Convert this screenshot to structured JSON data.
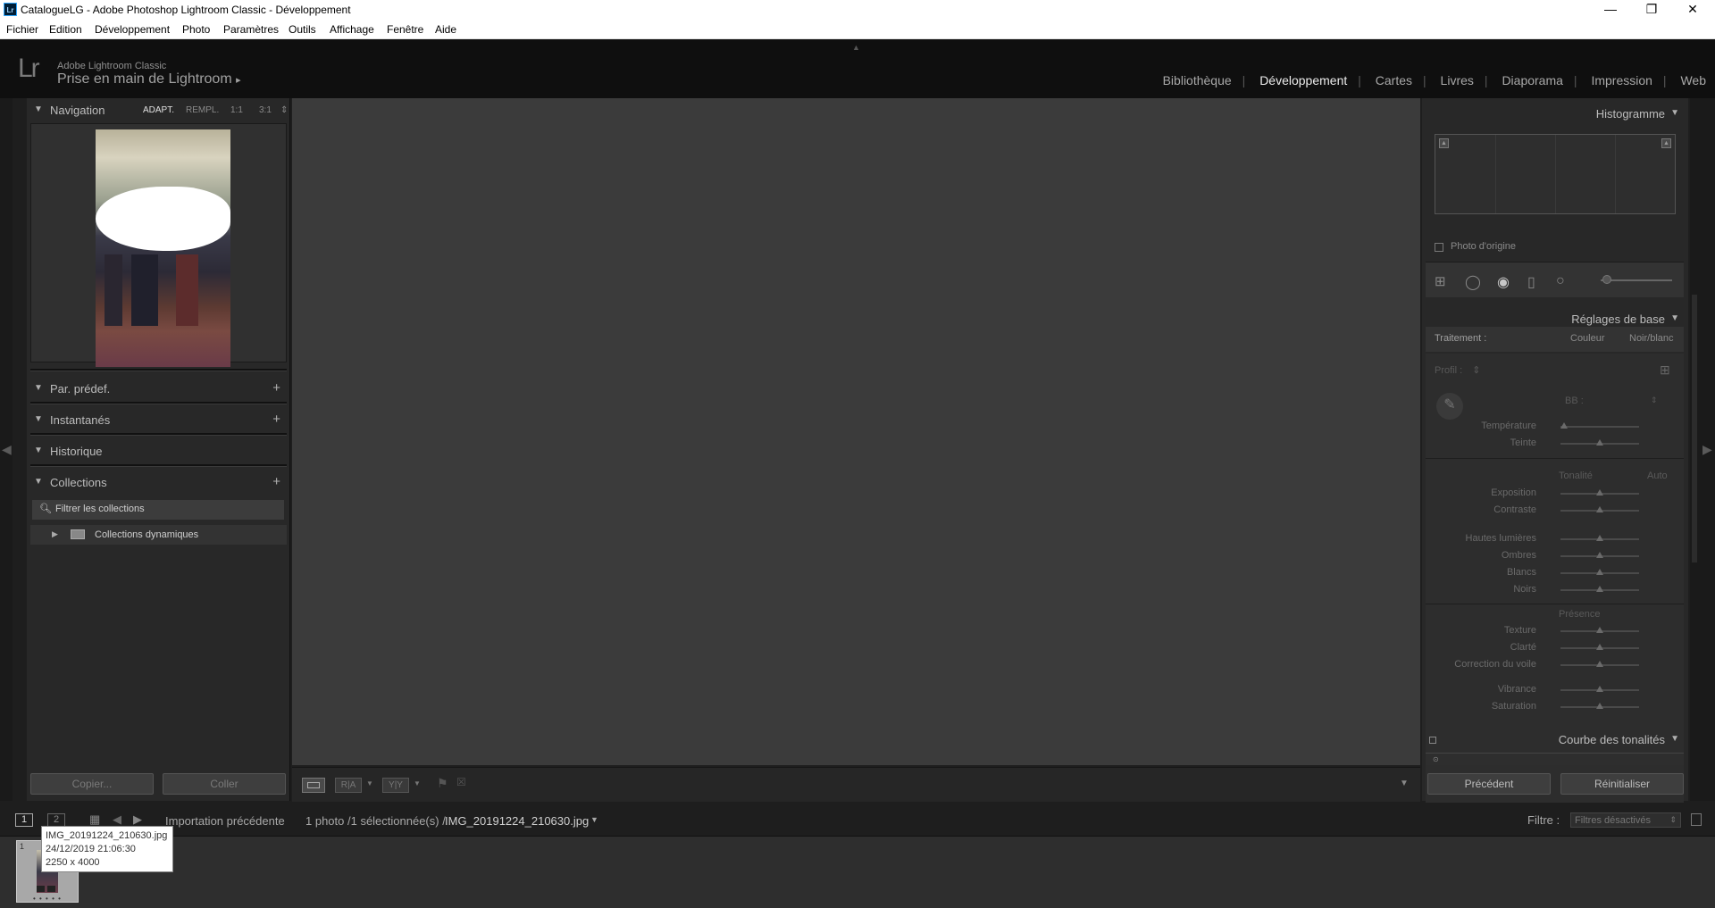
{
  "window": {
    "title": "CatalogueLG - Adobe Photoshop Lightroom Classic - Développement",
    "icon": "Lr",
    "minimize": "—",
    "restore": "❐",
    "close": "✕"
  },
  "menu": [
    "Fichier",
    "Edition",
    "Développement",
    "Photo",
    "Paramètres",
    "Outils",
    "Affichage",
    "Fenêtre",
    "Aide"
  ],
  "identity": {
    "logo": "Lr",
    "app_name": "Adobe Lightroom Classic",
    "catalog_title": "Prise en main de Lightroom",
    "catalog_arrow": "▸"
  },
  "modules": [
    {
      "label": "Bibliothèque",
      "active": false
    },
    {
      "label": "Développement",
      "active": true
    },
    {
      "label": "Cartes",
      "active": false
    },
    {
      "label": "Livres",
      "active": false
    },
    {
      "label": "Diaporama",
      "active": false
    },
    {
      "label": "Impression",
      "active": false
    },
    {
      "label": "Web",
      "active": false
    }
  ],
  "left": {
    "navigation": {
      "title": "Navigation",
      "zoom": [
        "ADAPT.",
        "REMPL.",
        "1:1",
        "3:1"
      ]
    },
    "presets": {
      "title": "Par. prédef."
    },
    "snapshots": {
      "title": "Instantanés"
    },
    "history": {
      "title": "Historique"
    },
    "collections": {
      "title": "Collections",
      "filter_label": "Filtrer les collections",
      "items": [
        {
          "label": "Collections dynamiques"
        }
      ]
    },
    "copy_button": "Copier...",
    "paste_button": "Coller"
  },
  "right": {
    "histogram": {
      "title": "Histogramme",
      "original_photo": "Photo d'origine"
    },
    "basic": {
      "title": "Réglages de base",
      "treatment_label": "Traitement :",
      "color": "Couleur",
      "bw": "Noir/blanc",
      "profile_label": "Profil :",
      "wb_label": "BB :",
      "tone_label": "Tonalité",
      "auto": "Auto",
      "presence_label": "Présence",
      "sliders_wb": [
        {
          "label": "Température",
          "value": 0.05
        },
        {
          "label": "Teinte",
          "value": 0.5
        }
      ],
      "sliders_tone1": [
        {
          "label": "Exposition",
          "value": 0.5
        },
        {
          "label": "Contraste",
          "value": 0.5
        }
      ],
      "sliders_tone2": [
        {
          "label": "Hautes lumières",
          "value": 0.5
        },
        {
          "label": "Ombres",
          "value": 0.5
        },
        {
          "label": "Blancs",
          "value": 0.5
        },
        {
          "label": "Noirs",
          "value": 0.5
        }
      ],
      "sliders_presence1": [
        {
          "label": "Texture",
          "value": 0.5
        },
        {
          "label": "Clarté",
          "value": 0.5
        },
        {
          "label": "Correction du voile",
          "value": 0.5
        }
      ],
      "sliders_presence2": [
        {
          "label": "Vibrance",
          "value": 0.5
        },
        {
          "label": "Saturation",
          "value": 0.5
        }
      ]
    },
    "tone_curve": {
      "title": "Courbe des tonalités"
    },
    "previous_button": "Précédent",
    "reset_button": "Réinitialiser"
  },
  "toolbar": {
    "ra": "R|A",
    "yy": "Y|Y"
  },
  "filmbar": {
    "page1": "1",
    "page2": "2",
    "source": "Importation précédente",
    "count": "1 photo /1 sélectionnée(s) /",
    "filename": "IMG_20191224_210630.jpg",
    "filter_label": "Filtre :",
    "filter_value": "Filtres désactivés"
  },
  "tooltip": {
    "filename": "IMG_20191224_210630.jpg",
    "date": "24/12/2019 21:06:30",
    "size": "2250 x 4000"
  },
  "thumb_index": "1"
}
